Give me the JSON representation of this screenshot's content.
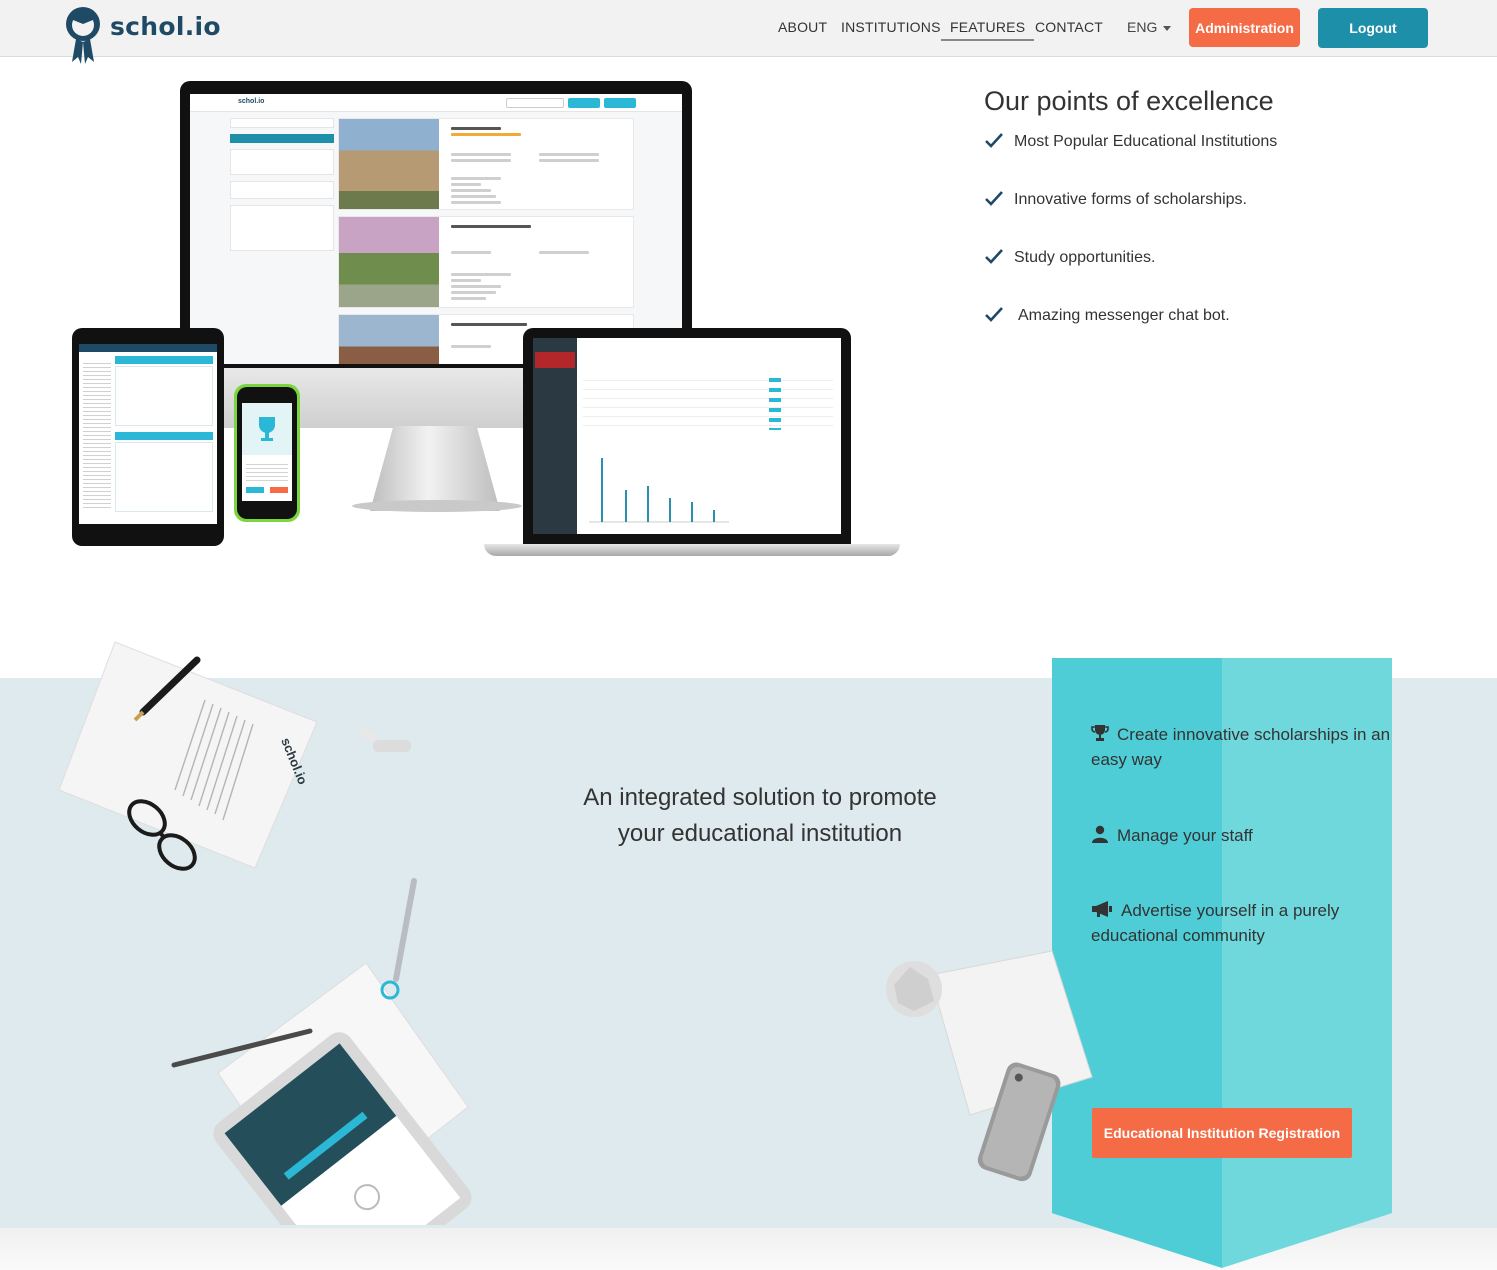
{
  "navbar": {
    "logo_text": "schol.io",
    "links": [
      {
        "label": "ABOUT"
      },
      {
        "label": "INSTITUTIONS"
      },
      {
        "label": "FEATURES"
      },
      {
        "label": "CONTACT"
      }
    ],
    "active_link": "FEATURES",
    "language": "ENG",
    "admin_label": "Administration",
    "logout_label": "Logout"
  },
  "excellence": {
    "title": "Our points of excellence",
    "items": [
      "Most Popular Educational Institutions",
      "Innovative forms of scholarships.",
      "Study opportunities.",
      "Amazing messenger chat bot."
    ]
  },
  "promo": {
    "tagline": "An integrated solution to promote your educational institution",
    "features": [
      {
        "icon": "trophy-icon",
        "text": "Create innovative scholarships in an easy way"
      },
      {
        "icon": "user-icon",
        "text": "Manage your staff"
      },
      {
        "icon": "megaphone-icon",
        "text": "Advertise yourself in a purely educational community"
      }
    ],
    "register_label": "Educational Institution Registration"
  },
  "colors": {
    "brand_dark": "#1f4a66",
    "accent_orange": "#f46b45",
    "accent_teal": "#1d8fa8",
    "ribbon_teal": "#4ecdd6",
    "band_bg": "#dfeaee"
  }
}
